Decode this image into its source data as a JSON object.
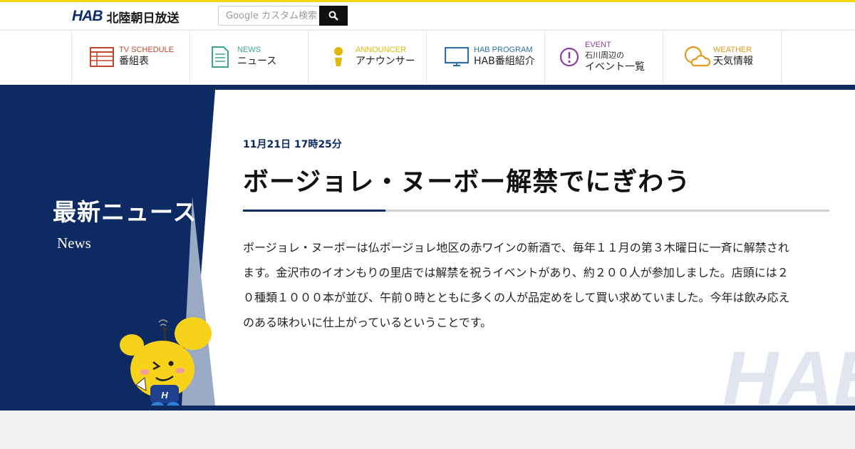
{
  "header": {
    "logo_mark": "HAB",
    "logo_text": "北陸朝日放送",
    "search_placeholder": "Google カスタム検索"
  },
  "nav": [
    {
      "en": "TV SCHEDULE",
      "ja": "番組表",
      "color": "#c1442b",
      "icon": "tv-schedule-icon"
    },
    {
      "en": "NEWS",
      "ja": "ニュース",
      "color": "#3aa58e",
      "icon": "news-icon"
    },
    {
      "en": "ANNOUNCER",
      "ja": "アナウンサー",
      "color": "#e0b800",
      "icon": "announcer-icon"
    },
    {
      "en": "HAB PROGRAM",
      "ja": "HAB番組紹介",
      "color": "#2f6fa8",
      "icon": "program-icon"
    },
    {
      "en": "EVENT",
      "ja_line1": "石川周辺の",
      "ja_line2": "イベント一覧",
      "color": "#8a3fa0",
      "icon": "event-icon"
    },
    {
      "en": "WEATHER",
      "ja": "天気情報",
      "color": "#e59a1a",
      "icon": "weather-icon"
    }
  ],
  "section": {
    "title": "最新ニュース",
    "subtitle": "News"
  },
  "article": {
    "date": "11月21日 17時25分",
    "headline": "ボージョレ・ヌーボー解禁でにぎわう",
    "body": "ボージョレ・ヌーボーは仏ボージョレ地区の赤ワインの新酒で、毎年１１月の第３木曜日に一斉に解禁されます。金沢市のイオンもりの里店では解禁を祝うイベントがあり、約２００人が参加しました。店頭には２０種類１０００本が並び、午前０時とともに多くの人が品定めをして買い求めていました。今年は飲み応えのある味わいに仕上がっているということです。"
  },
  "watermark": "HAB",
  "colors": {
    "navy": "#0d2a62",
    "yellow": "#f3d800",
    "mascot": "#f7d21a"
  }
}
